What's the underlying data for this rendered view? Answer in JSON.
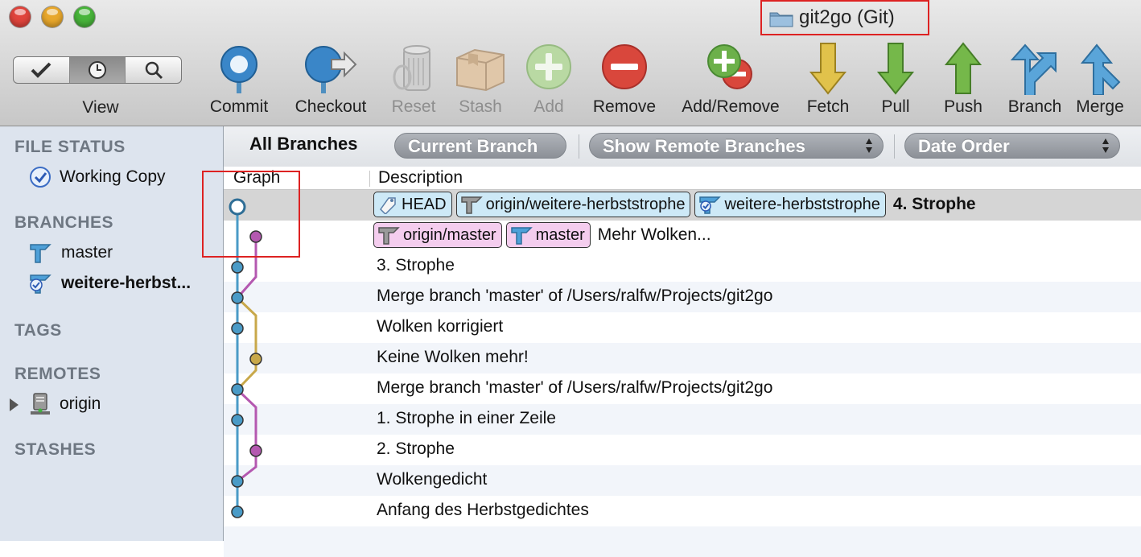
{
  "window": {
    "title": "git2go (Git)"
  },
  "toolbar": {
    "view_label": "View",
    "buttons": [
      {
        "label": "Commit",
        "icon": "commit-icon",
        "enabled": true
      },
      {
        "label": "Checkout",
        "icon": "checkout-icon",
        "enabled": true
      },
      {
        "label": "Reset",
        "icon": "reset-icon",
        "enabled": false
      },
      {
        "label": "Stash",
        "icon": "stash-icon",
        "enabled": false
      },
      {
        "label": "Add",
        "icon": "add-icon",
        "enabled": false
      },
      {
        "label": "Remove",
        "icon": "remove-icon",
        "enabled": true
      },
      {
        "label": "Add/Remove",
        "icon": "add-remove-icon",
        "enabled": true
      },
      {
        "label": "Fetch",
        "icon": "fetch-icon",
        "enabled": true
      },
      {
        "label": "Pull",
        "icon": "pull-icon",
        "enabled": true
      },
      {
        "label": "Push",
        "icon": "push-icon",
        "enabled": true
      },
      {
        "label": "Branch",
        "icon": "branch-icon",
        "enabled": true
      },
      {
        "label": "Merge",
        "icon": "merge-icon",
        "enabled": true
      }
    ]
  },
  "sidebar": {
    "file_status": "FILE STATUS",
    "working_copy": "Working Copy",
    "branches": "BRANCHES",
    "branch_items": [
      "master",
      "weitere-herbst..."
    ],
    "tags": "TAGS",
    "remotes": "REMOTES",
    "remote_items": [
      "origin"
    ],
    "stashes": "STASHES"
  },
  "filter": {
    "all_branches": "All Branches",
    "current_branch": "Current Branch",
    "show_remote": "Show Remote Branches",
    "date_order": "Date Order"
  },
  "columns": {
    "graph": "Graph",
    "description": "Description"
  },
  "commits": [
    {
      "refs": [
        "HEAD",
        "origin/weitere-herbststrophe",
        "weitere-herbststrophe"
      ],
      "message": "4. Strophe"
    },
    {
      "refs": [
        "origin/master",
        "master"
      ],
      "message": "Mehr Wolken..."
    },
    {
      "message": "3. Strophe"
    },
    {
      "message": "Merge branch 'master' of /Users/ralfw/Projects/git2go"
    },
    {
      "message": "Wolken korrigiert"
    },
    {
      "message": "Keine Wolken mehr!"
    },
    {
      "message": "Merge branch 'master' of /Users/ralfw/Projects/git2go"
    },
    {
      "message": "1. Strophe in einer Zeile"
    },
    {
      "message": "2. Strophe"
    },
    {
      "message": "Wolkengedicht"
    },
    {
      "message": "Anfang des Herbstgedichtes"
    }
  ],
  "colors": {
    "lane_blue": "#4a9bc7",
    "lane_pink": "#b458b0",
    "lane_gold": "#c8a84a",
    "highlight_red": "#dd2222"
  }
}
